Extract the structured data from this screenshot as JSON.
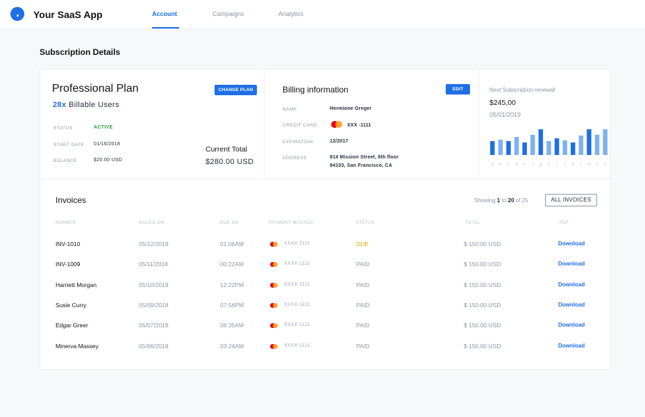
{
  "app": {
    "title": "Your SaaS App",
    "brand_color": "#1f6fe5"
  },
  "nav": {
    "tabs": [
      {
        "label": "Account",
        "active": true
      },
      {
        "label": "Campaigns",
        "active": false
      },
      {
        "label": "Analytics",
        "active": false
      }
    ]
  },
  "page": {
    "section_title": "Subscription Details"
  },
  "plan": {
    "name": "Professional Plan",
    "change_label": "CHANGE PLAN",
    "users_count": "28x",
    "users_label": "Billable Users",
    "status_label": "STATUS",
    "status_value": "ACTIVE",
    "start_label": "START DATE",
    "start_value": "01/16/2018",
    "balance_label": "BALANCE",
    "balance_value": "$20.00 USD",
    "total_label": "Current Total",
    "total_value": "$280.00 USD"
  },
  "billing": {
    "title": "Billing information",
    "edit_label": "EDIT",
    "name_label": "NAME",
    "name_value": "Hermione Greger",
    "card_label": "CREDIT CARD",
    "card_value": "XXX -1111",
    "card_icon": "mastercard-icon",
    "expiration_label": "EXPIRATION",
    "expiration_value": "12/2017",
    "address_label": "ADDRESS",
    "address_line1": "814 Mission Street, 6th floor",
    "address_line2": "94103, San Francisco, CA"
  },
  "renewal": {
    "label": "Next Subscription renewall",
    "amount": "$245,00",
    "date": "05/01/2019"
  },
  "chart_data": {
    "type": "bar",
    "categories": [
      "a",
      "b",
      "c",
      "d",
      "e",
      "f",
      "g",
      "h",
      "i",
      "j",
      "k",
      "l",
      "m",
      "n",
      "o"
    ],
    "values": [
      20,
      22,
      20,
      26,
      18,
      29,
      37,
      20,
      24,
      21,
      18,
      28,
      37,
      29,
      37
    ],
    "highlight": [
      true,
      false,
      true,
      false,
      true,
      false,
      true,
      false,
      true,
      false,
      true,
      false,
      true,
      false,
      false
    ],
    "colors": {
      "dark": "#1f6fe5",
      "light": "#7eb1f0"
    },
    "ylim": [
      0,
      40
    ],
    "grid": false,
    "title": "",
    "xlabel": "",
    "ylabel": ""
  },
  "invoices": {
    "title": "Invoices",
    "showing_prefix": "Showing",
    "showing_from": "1",
    "showing_to_word": "to",
    "showing_to": "20",
    "showing_of_word": "of",
    "showing_total": "25",
    "all_label": "ALL INVOICES",
    "headers": {
      "number": "NUMBER",
      "billed": "BILLED ON",
      "due": "DUE ON",
      "payment": "PAYMENT MEHTOD",
      "status": "STATUS",
      "total": "TOTAL",
      "pdf": "PDF"
    },
    "rows": [
      {
        "number": "INV-1010",
        "billed": "05/12/2018",
        "due": "01:06AM",
        "payment": "XXXX-1111",
        "status": "DUE",
        "total": "$ 150.00 USD",
        "pdf": "Download"
      },
      {
        "number": "INV-1009",
        "billed": "05/11/2018",
        "due": "00:22AM",
        "payment": "XXXX-1111",
        "status": "PAID",
        "total": "$ 150.00 USD",
        "pdf": "Download"
      },
      {
        "number": "Harriett Morgan",
        "billed": "05/10/2018",
        "due": "12:22PM",
        "payment": "XXXX-1111",
        "status": "PAID",
        "total": "$ 150.00 USD",
        "pdf": "Download"
      },
      {
        "number": "Susie Curry",
        "billed": "05/09/2018",
        "due": "07:56PM",
        "payment": "XXXX-1111",
        "status": "PAID",
        "total": "$ 150.00 USD",
        "pdf": "Download"
      },
      {
        "number": "Edgar Greer",
        "billed": "05/07/2018",
        "due": "08:35AM",
        "payment": "XXXX-1111",
        "status": "PAID",
        "total": "$ 150.00 USD",
        "pdf": "Download"
      },
      {
        "number": "Minerva Massey",
        "billed": "05/06/2018",
        "due": "03:24AM",
        "payment": "XXXX-1111",
        "status": "PAID",
        "total": "$ 150.00 USD",
        "pdf": "Download"
      }
    ]
  }
}
